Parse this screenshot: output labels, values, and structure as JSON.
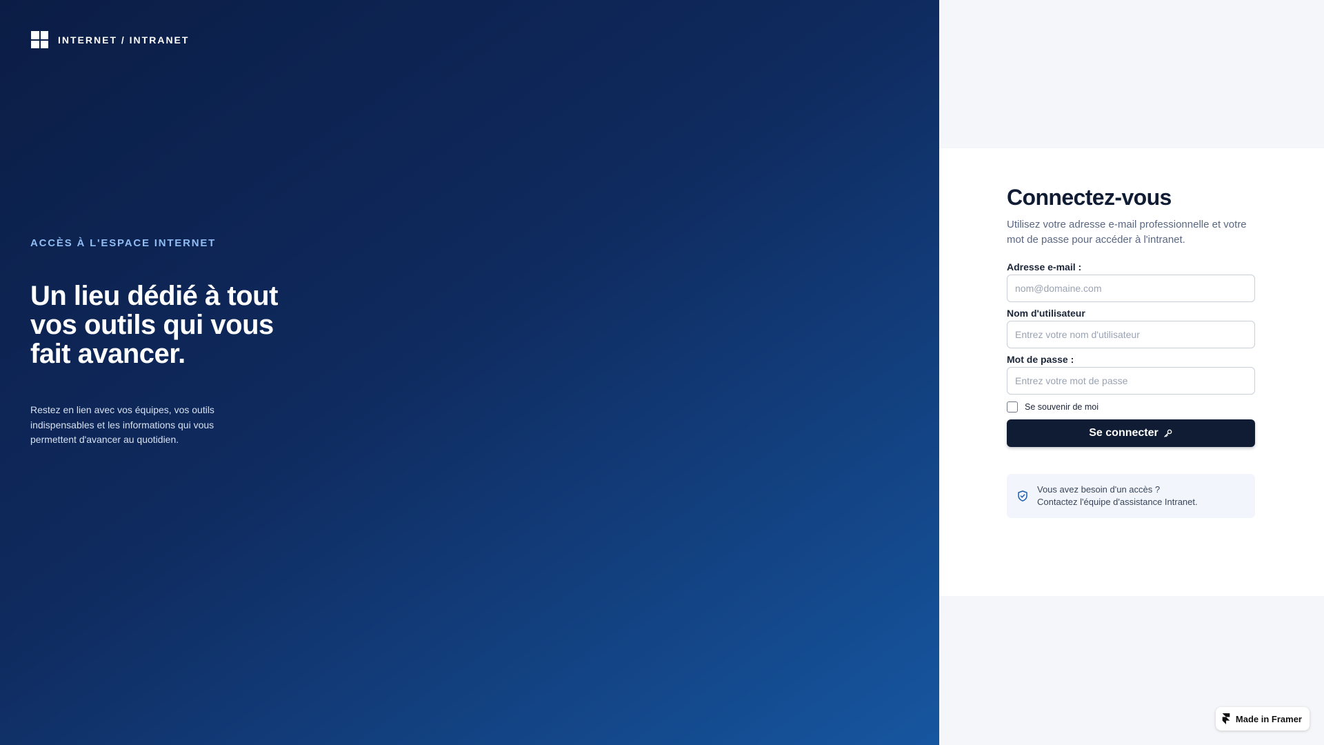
{
  "brand": {
    "logo_icon": "windows-grid-icon",
    "name": "INTERNET / INTRANET"
  },
  "hero": {
    "eyebrow": "ACCÈS À L'ESPACE INTERNET",
    "headline": "Un lieu dédié à tout vos outils qui vous fait avancer.",
    "description": "Restez en lien avec vos équipes, vos outils indispensables et les informations qui vous permettent d'avancer au quotidien.",
    "gradient_colors": [
      "#0b1d45",
      "#1656a0"
    ]
  },
  "login": {
    "title": "Connectez-vous",
    "subtitle": "Utilisez votre adresse e-mail professionnelle et votre mot de passe pour accéder à l'intranet.",
    "email": {
      "label": "Adresse e-mail :",
      "value": "",
      "placeholder": "nom@domaine.com"
    },
    "username": {
      "label": "Nom d'utilisateur",
      "value": "",
      "placeholder": "Entrez votre nom d'utilisateur"
    },
    "password": {
      "label": "Mot de passe :",
      "value": "",
      "placeholder": "Entrez votre mot de passe"
    },
    "remember": {
      "label": "Se souvenir de moi",
      "checked": false
    },
    "submit": {
      "label": "Se connecter",
      "icon": "key-icon",
      "color": "#0f1c33"
    },
    "help": {
      "icon": "shield-check-icon",
      "line1": "Vous avez besoin d'un accès ?",
      "line2": "Contactez l'équipe d'assistance Intranet."
    }
  },
  "framer_badge": {
    "icon": "framer-icon",
    "label": "Made in Framer"
  }
}
